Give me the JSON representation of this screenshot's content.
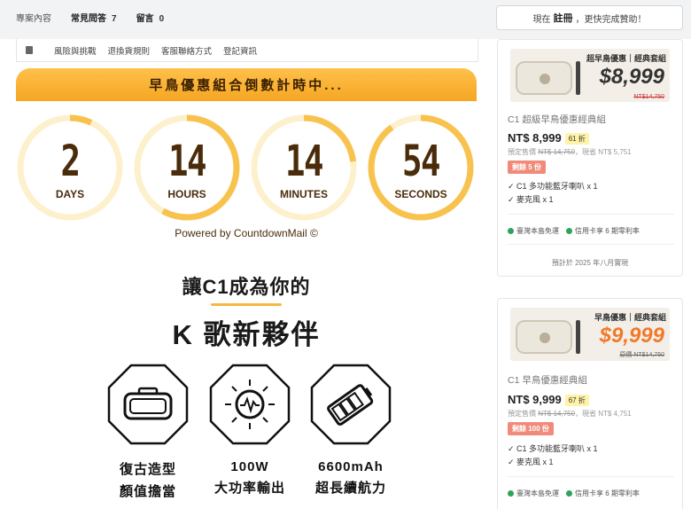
{
  "topnav": {
    "items": [
      {
        "label": "專案內容",
        "count": ""
      },
      {
        "label": "常見問答",
        "count": "7"
      },
      {
        "label": "留言",
        "count": "0"
      }
    ]
  },
  "subnav": {
    "items": [
      "風險與挑戰",
      "退換貨規則",
      "客服聯絡方式",
      "登記資訊"
    ]
  },
  "cta": {
    "prefix": "現在",
    "register": "註冊",
    "suffix": "，更快完成贊助！"
  },
  "countdown": {
    "banner": "早鳥優惠組合倒數計時中...",
    "units": [
      {
        "value": "2",
        "label": "DAYS",
        "progress": 0.07
      },
      {
        "value": "14",
        "label": "HOURS",
        "progress": 0.58
      },
      {
        "value": "14",
        "label": "MINUTES",
        "progress": 0.23
      },
      {
        "value": "54",
        "label": "SECONDS",
        "progress": 0.9
      }
    ],
    "powered": "Powered by CountdownMail ©"
  },
  "headline": {
    "line1": "讓C1成為你的",
    "line2": "K 歌新夥伴"
  },
  "features": [
    {
      "icon": "speaker-icon",
      "line1": "復古造型",
      "line2": "顏值擔當"
    },
    {
      "icon": "power-icon",
      "line1": "100W",
      "line2": "大功率輸出"
    },
    {
      "icon": "battery-icon",
      "line1": "6600mAh",
      "line2": "超長續航力"
    }
  ],
  "rewards": [
    {
      "img_tag": "超早鳥優惠｜經典套組",
      "img_price": "$8,999",
      "img_orig": "NT$14,750",
      "title": "C1 超級早鳥優惠經典組",
      "price": "NT$ 8,999",
      "discount": "61 折",
      "orig_label": "預定售價",
      "orig_price": "NT$ 14,750",
      "save": "，現省 NT$ 5,751",
      "remaining": "剩餘 5 份",
      "includes": [
        "✓ C1 多功能藍牙喇叭 x 1",
        "✓ 麥克風 x 1"
      ],
      "badge1": "臺灣本島免運",
      "badge2": "信用卡享 6 期零利率",
      "eta": "預計於 2025 年八月實現"
    },
    {
      "img_tag": "早鳥優惠｜經典套組",
      "img_price": "$9,999",
      "img_orig": "原價 NT$14,750",
      "title": "C1 早鳥優惠經典組",
      "price": "NT$ 9,999",
      "discount": "67 折",
      "orig_label": "預定售價",
      "orig_price": "NT$ 14,750",
      "save": "，現省 NT$ 4,751",
      "remaining": "剩餘 100 份",
      "includes": [
        "✓ C1 多功能藍牙喇叭 x 1",
        "✓ 麥克風 x 1"
      ],
      "badge1": "臺灣本島免運",
      "badge2": "信用卡享 6 期零利率"
    }
  ],
  "colors": {
    "accent": "#f5a623",
    "ring_track": "#fdf0cc",
    "ring_fill": "#f8c24f",
    "dark_brown": "#4a2c0b",
    "remaining_badge": "#f08a7a",
    "discount_badge": "#fff3a8"
  }
}
